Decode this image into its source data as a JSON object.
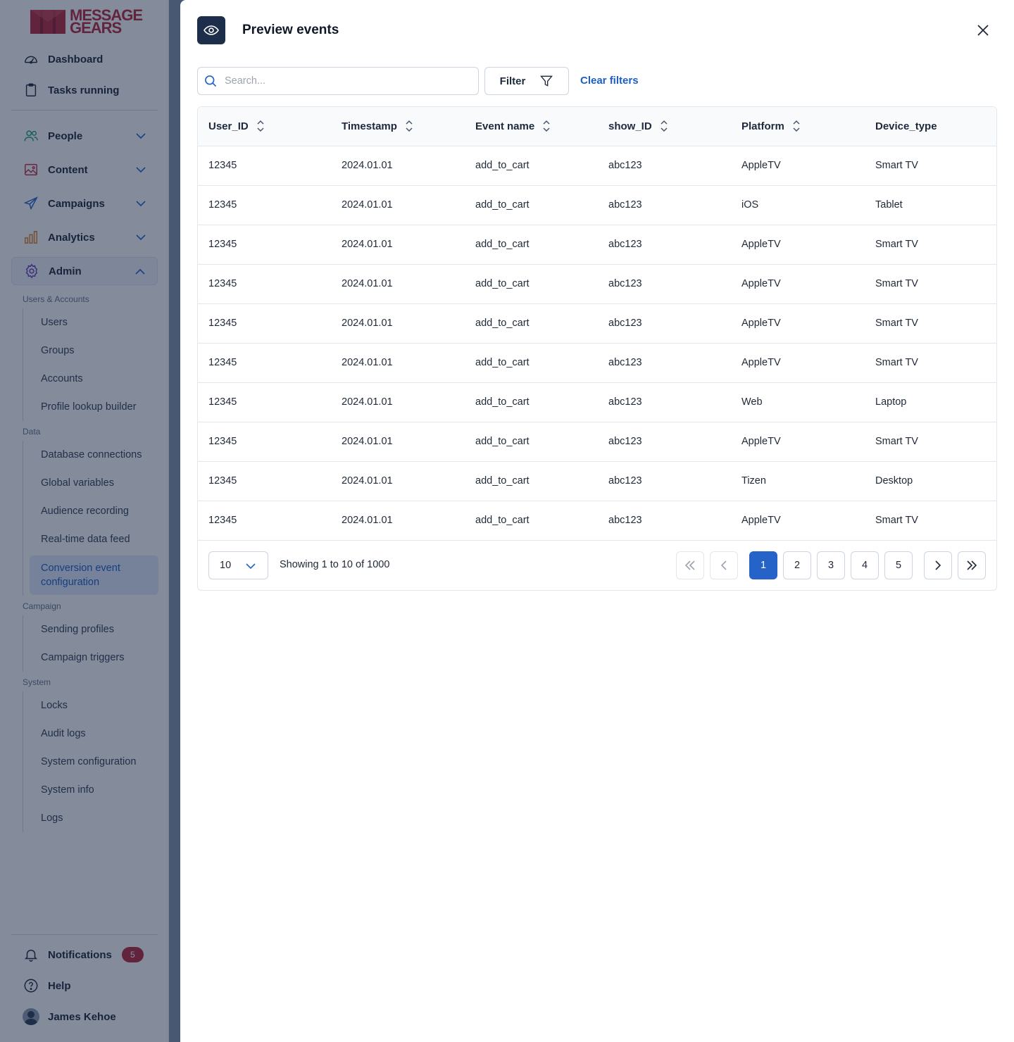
{
  "brand": {
    "line1": "MESSAGE",
    "line2": "GEARS"
  },
  "sidebar": {
    "main": [
      {
        "label": "Dashboard",
        "icon": "gauge-icon"
      },
      {
        "label": "Tasks running",
        "icon": "clipboard-icon"
      }
    ],
    "groups": [
      {
        "label": "People",
        "icon": "people-icon"
      },
      {
        "label": "Content",
        "icon": "image-icon"
      },
      {
        "label": "Campaigns",
        "icon": "send-icon"
      },
      {
        "label": "Analytics",
        "icon": "bar-chart-icon"
      },
      {
        "label": "Admin",
        "icon": "gear-icon"
      }
    ],
    "sections": {
      "users_accounts": {
        "title": "Users & Accounts",
        "items": [
          "Users",
          "Groups",
          "Accounts",
          "Profile lookup builder"
        ]
      },
      "data": {
        "title": "Data",
        "items": [
          "Database connections",
          "Global variables",
          "Audience recording",
          "Real-time data feed",
          "Conversion event configuration"
        ]
      },
      "campaign": {
        "title": "Campaign",
        "items": [
          "Sending profiles",
          "Campaign triggers"
        ]
      },
      "system": {
        "title": "System",
        "items": [
          "Locks",
          "Audit logs",
          "System configuration",
          "System info",
          "Logs"
        ]
      }
    },
    "bottom": {
      "notifications": {
        "label": "Notifications",
        "count": "5"
      },
      "help": {
        "label": "Help"
      },
      "user": {
        "label": "James Kehoe"
      }
    }
  },
  "modal": {
    "title": "Preview events",
    "search_placeholder": "Search...",
    "filter_label": "Filter",
    "clear_filters_label": "Clear filters",
    "columns": [
      "User_ID",
      "Timestamp",
      "Event name",
      "show_ID",
      "Platform",
      "Device_type"
    ],
    "rows": [
      [
        "12345",
        "2024.01.01",
        "add_to_cart",
        "abc123",
        "AppleTV",
        "Smart TV"
      ],
      [
        "12345",
        "2024.01.01",
        "add_to_cart",
        "abc123",
        "iOS",
        "Tablet"
      ],
      [
        "12345",
        "2024.01.01",
        "add_to_cart",
        "abc123",
        "AppleTV",
        "Smart TV"
      ],
      [
        "12345",
        "2024.01.01",
        "add_to_cart",
        "abc123",
        "AppleTV",
        "Smart TV"
      ],
      [
        "12345",
        "2024.01.01",
        "add_to_cart",
        "abc123",
        "AppleTV",
        "Smart TV"
      ],
      [
        "12345",
        "2024.01.01",
        "add_to_cart",
        "abc123",
        "AppleTV",
        "Smart TV"
      ],
      [
        "12345",
        "2024.01.01",
        "add_to_cart",
        "abc123",
        "Web",
        "Laptop"
      ],
      [
        "12345",
        "2024.01.01",
        "add_to_cart",
        "abc123",
        "AppleTV",
        "Smart TV"
      ],
      [
        "12345",
        "2024.01.01",
        "add_to_cart",
        "abc123",
        "Tizen",
        "Desktop"
      ],
      [
        "12345",
        "2024.01.01",
        "add_to_cart",
        "abc123",
        "AppleTV",
        "Smart TV"
      ]
    ],
    "pagination": {
      "page_size": "10",
      "showing_text": "Showing 1 to 10 of 1000",
      "pages": [
        "1",
        "2",
        "3",
        "4",
        "5"
      ],
      "current_page": "1"
    }
  },
  "colors": {
    "brand": "#b4293f",
    "accent": "#2563c9",
    "header_icon_bg": "#1c2e4a"
  }
}
